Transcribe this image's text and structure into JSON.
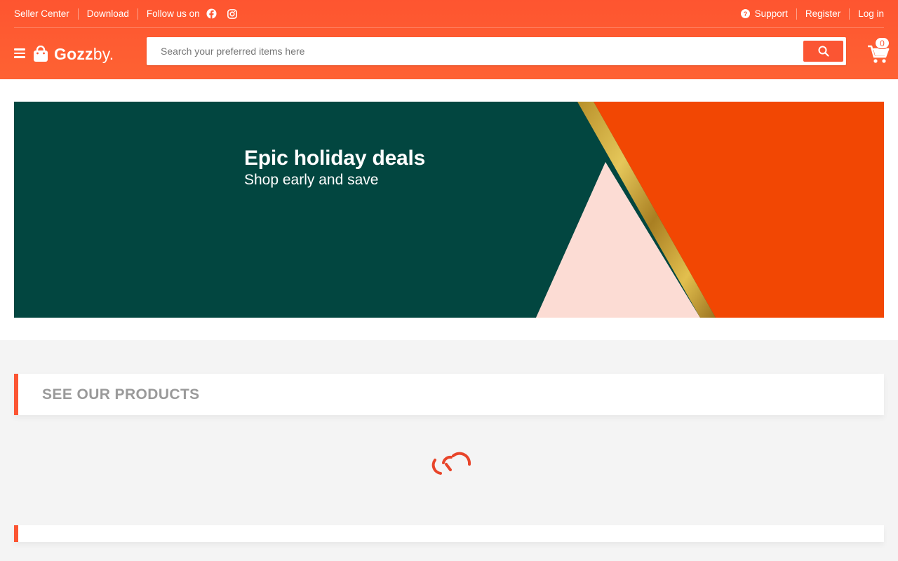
{
  "topbar": {
    "seller_center": "Seller Center",
    "download": "Download",
    "follow_us": "Follow us on",
    "social_icons": [
      "facebook-icon",
      "instagram-icon"
    ],
    "support": "Support",
    "register": "Register",
    "login": "Log in"
  },
  "header": {
    "logo_bold": "Gozz",
    "logo_light": "by.",
    "search": {
      "placeholder": "Search your preferred items here",
      "value": ""
    },
    "cart_count": "0"
  },
  "banner": {
    "title": "Epic holiday deals",
    "subtitle": "Shop early and save"
  },
  "products": {
    "title": "SEE OUR PRODUCTS"
  },
  "colors": {
    "brand": "#fe5530",
    "banner_green": "#024640",
    "banner_orange": "#f24703",
    "banner_pink": "#fcdcd4",
    "gold": "#c9a235"
  }
}
